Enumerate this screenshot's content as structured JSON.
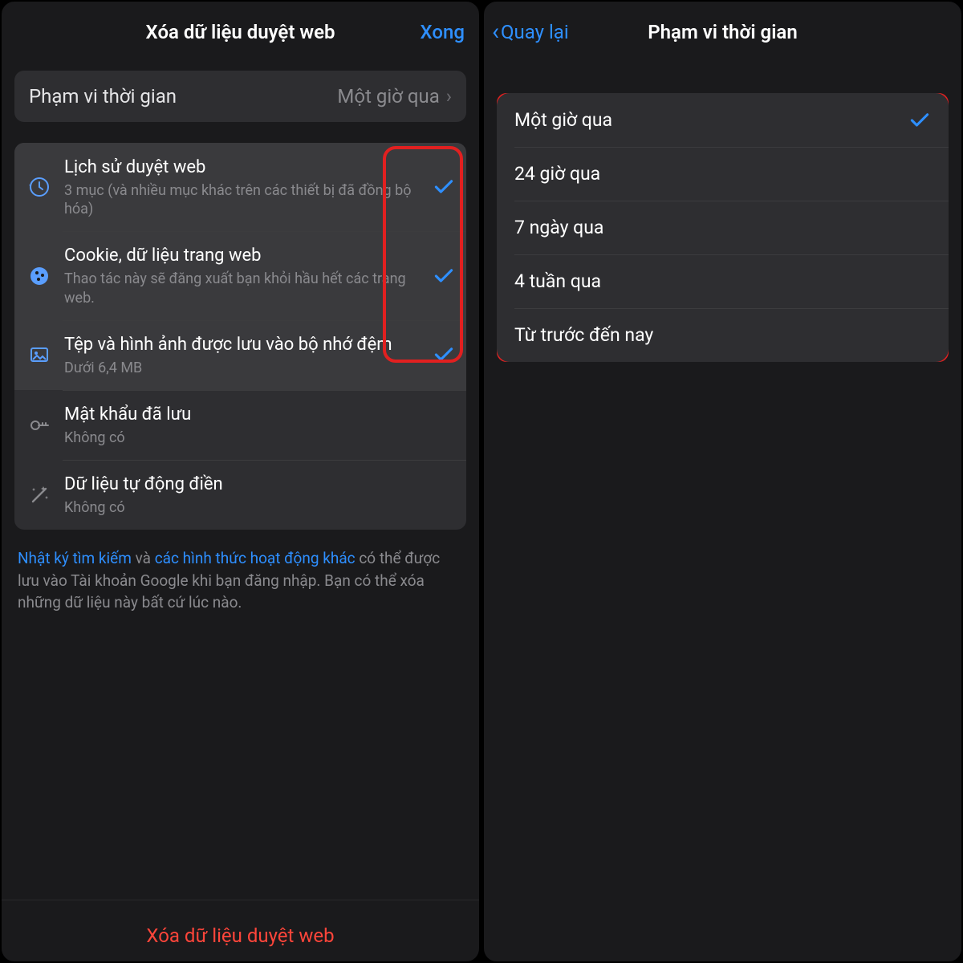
{
  "left": {
    "title": "Xóa dữ liệu duyệt web",
    "done": "Xong",
    "timeRange": {
      "label": "Phạm vi thời gian",
      "value": "Một giờ qua"
    },
    "items": [
      {
        "title": "Lịch sử duyệt web",
        "sub": "3 mục (và nhiều mục khác trên các thiết bị đã đồng bộ hóa)",
        "icon": "history",
        "selected": true,
        "checked": true
      },
      {
        "title": "Cookie, dữ liệu trang web",
        "sub": "Thao tác này sẽ đăng xuất bạn khỏi hầu hết các trang web.",
        "icon": "cookie",
        "selected": true,
        "checked": true
      },
      {
        "title": "Tệp và hình ảnh được lưu vào bộ nhớ đệm",
        "sub": "Dưới 6,4 MB",
        "icon": "image",
        "selected": true,
        "checked": true
      },
      {
        "title": "Mật khẩu đã lưu",
        "sub": "Không có",
        "icon": "key",
        "selected": false,
        "checked": false
      },
      {
        "title": "Dữ liệu tự động điền",
        "sub": "Không có",
        "icon": "wand",
        "selected": false,
        "checked": false
      }
    ],
    "note": {
      "link1": "Nhật ký tìm kiếm",
      "mid1": " và ",
      "link2": "các hình thức hoạt động khác",
      "rest": " có thể được lưu vào Tài khoản Google khi bạn đăng nhập. Bạn có thể xóa những dữ liệu này bất cứ lúc nào."
    },
    "clearButton": "Xóa dữ liệu duyệt web"
  },
  "right": {
    "back": "Quay lại",
    "title": "Phạm vi thời gian",
    "options": [
      {
        "label": "Một giờ qua",
        "checked": true
      },
      {
        "label": "24 giờ qua",
        "checked": false
      },
      {
        "label": "7 ngày qua",
        "checked": false
      },
      {
        "label": "4 tuần qua",
        "checked": false
      },
      {
        "label": "Từ trước đến nay",
        "checked": false
      }
    ]
  },
  "colors": {
    "accent": "#2e8fff",
    "danger": "#ff453a"
  }
}
